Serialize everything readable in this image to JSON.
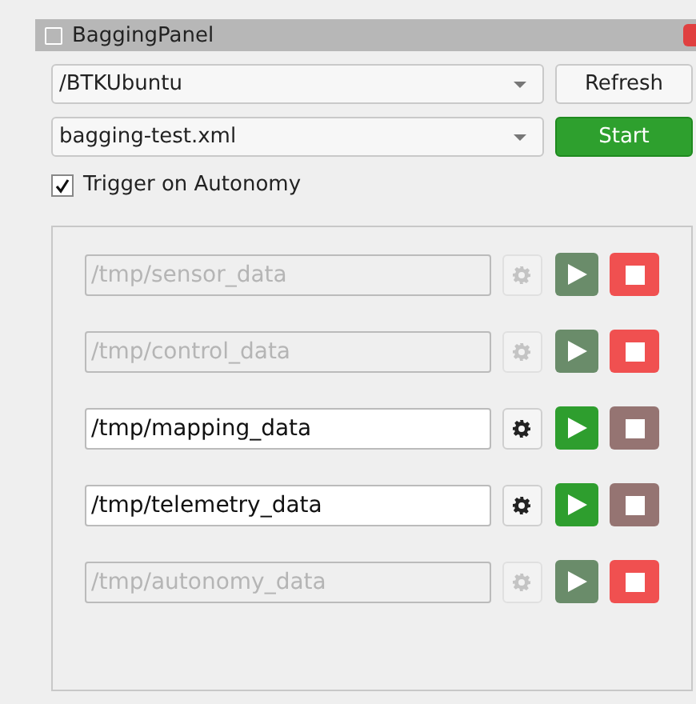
{
  "window": {
    "title": "BaggingPanel"
  },
  "host_combo": {
    "value": "/BTKUbuntu"
  },
  "refresh_button": "Refresh",
  "config_combo": {
    "value": "bagging-test.xml"
  },
  "start_button": "Start",
  "trigger": {
    "label": "Trigger on Autonomy",
    "checked": true
  },
  "recorders": [
    {
      "path": "/tmp/sensor_data",
      "recording": true
    },
    {
      "path": "/tmp/control_data",
      "recording": true
    },
    {
      "path": "/tmp/mapping_data",
      "recording": false
    },
    {
      "path": "/tmp/telemetry_data",
      "recording": false
    },
    {
      "path": "/tmp/autonomy_data",
      "recording": true
    }
  ]
}
